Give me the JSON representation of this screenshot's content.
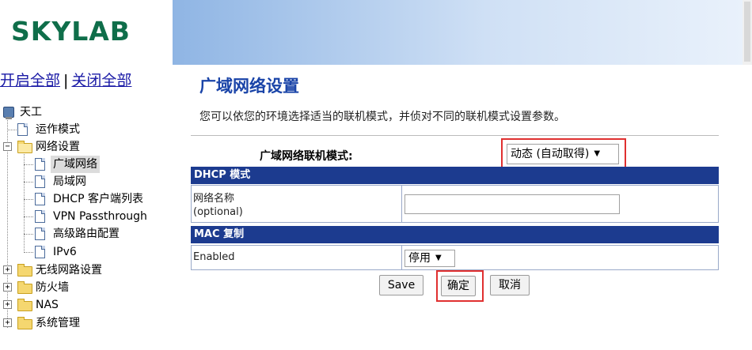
{
  "brand": {
    "logo_text": "SKYLAB"
  },
  "tree_controls": {
    "expand_all": "开启全部",
    "separator": "|",
    "collapse_all": "关闭全部"
  },
  "nav_tree": {
    "root": "天工",
    "operation_mode": "运作模式",
    "network_settings": "网络设置",
    "wan": "广域网络",
    "lan": "局域网",
    "dhcp_clients": "DHCP 客户端列表",
    "vpn_passthrough": "VPN Passthrough",
    "advanced_routing": "高级路由配置",
    "ipv6": "IPv6",
    "wireless_settings": "无线网路设置",
    "firewall": "防火墙",
    "nas": "NAS",
    "system_management": "系统管理",
    "expand_symbol": "+",
    "collapse_symbol": "−"
  },
  "page": {
    "title": "广域网络设置",
    "description": "您可以依您的环境选择适当的联机模式，并侦对不同的联机模式设置参数。"
  },
  "wan_form": {
    "connection_mode_label": "广域网络联机模式:",
    "connection_mode_value": "动态 (自动取得)",
    "dhcp_section_title": "DHCP 模式",
    "hostname_label_line1": "网络名称",
    "hostname_label_line2": "(optional)",
    "hostname_value": "",
    "mac_clone_section_title": "MAC 复制",
    "mac_clone_enabled_label": "Enabled",
    "mac_clone_enabled_value": "停用",
    "dropdown_arrow": "▼"
  },
  "actions": {
    "save": "Save",
    "confirm": "确定",
    "cancel": "取消"
  },
  "colors": {
    "section_bar": "#1c3b8f",
    "page_title": "#1a44a8",
    "logo": "#0f6e4a",
    "highlight_box": "#e03030",
    "link": "#1a1aa6"
  },
  "icons": {
    "root": "computer-icon",
    "page": "document-icon",
    "folder": "folder-icon",
    "folder_open": "folder-open-icon"
  }
}
